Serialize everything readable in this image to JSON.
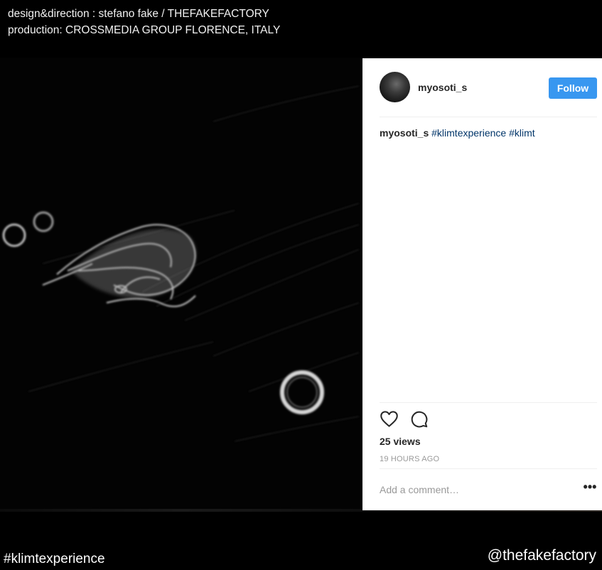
{
  "overlay": {
    "credit_line1": "design&direction : stefano fake / THEFAKEFACTORY",
    "credit_line2": "production: CROSSMEDIA GROUP FLORENCE, ITALY",
    "hashtag": "#klimtexperience",
    "handle": "@thefakefactory"
  },
  "post": {
    "username": "myosoti_s",
    "follow_label": "Follow",
    "caption_user": "myosoti_s",
    "caption_tags": [
      "#klimtexperience",
      "#klimt"
    ],
    "views": "25 views",
    "timestamp": "19 HOURS AGO",
    "comment_placeholder": "Add a comment…",
    "more_label": "•••"
  },
  "icons": {
    "like": "heart-icon",
    "comment": "comment-bubble-icon",
    "more": "more-options-icon"
  },
  "colors": {
    "follow_button": "#3897f0",
    "hashtag_link": "#003569",
    "text_primary": "#262626",
    "text_muted": "#999999",
    "background": "#000000"
  }
}
